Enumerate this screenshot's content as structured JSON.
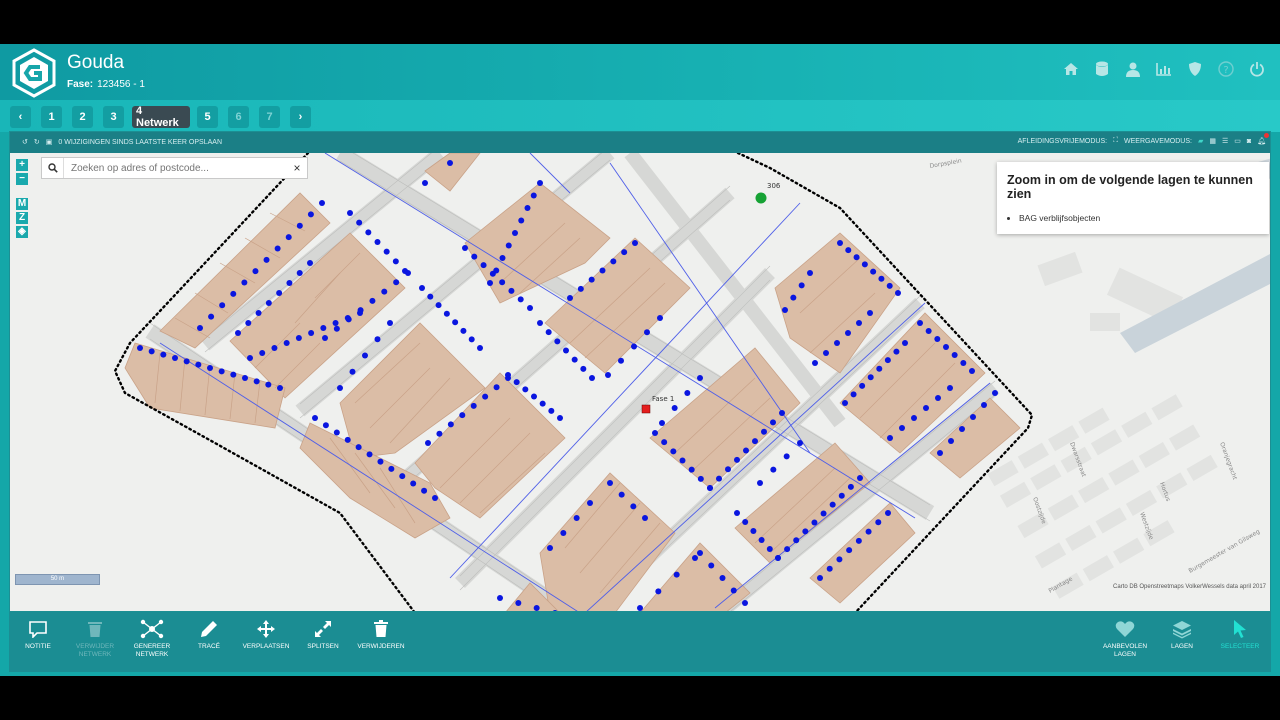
{
  "header": {
    "title": "Gouda",
    "fase_label": "Fase:",
    "fase_value": "123456 - 1",
    "icons": [
      "home-icon",
      "database-icon",
      "user-icon",
      "chart-icon",
      "shield-icon",
      "help-icon",
      "power-icon"
    ]
  },
  "steps": {
    "prev": "‹",
    "next": "›",
    "items": [
      "1",
      "2",
      "3",
      "4 Netwerk",
      "5",
      "6",
      "7"
    ],
    "active": "4 Netwerk"
  },
  "infobar": {
    "changes_text": "0 WIJZIGINGEN SINDS LAATSTE KEER OPSLAAN",
    "derive_mode": "AFLEIDINGSVRIJEMODUS:",
    "view_mode": "WEERGAVEMODUS:"
  },
  "map": {
    "zoom_in": "+",
    "zoom_out": "−",
    "mode_buttons": [
      "M",
      "Z"
    ],
    "search": {
      "placeholder": "Zoeken op adres of postcode...",
      "value": ""
    },
    "search_clear": "×",
    "layer_notice": {
      "title": "Zoom in om de volgende lagen te kunnen zien",
      "items": [
        "BAG verblijfsobjecten"
      ]
    },
    "labels": {
      "point_green": "306",
      "point_red": "Fase 1"
    },
    "scale": "50 m",
    "attribution": "Carto DB Openstreetmaps VolkerWessels data april 2017",
    "streets": [
      "Dorpsplein",
      "Oostzijde",
      "Westzijde",
      "Oranjegracht",
      "Burgemeester van Gilsweg",
      "Plantage",
      "Dwarsstraat",
      "Hortus"
    ]
  },
  "toolbar": {
    "left": [
      {
        "label": "NOTITIE",
        "icon": "comment-icon",
        "state": "normal"
      },
      {
        "label": "VERWIJDER NETWERK",
        "icon": "trash-icon",
        "state": "disabled"
      },
      {
        "label": "GENEREER NETWERK",
        "icon": "network-icon",
        "state": "normal"
      },
      {
        "label": "TRACÉ",
        "icon": "pencil-icon",
        "state": "normal"
      },
      {
        "label": "VERPLAATSEN",
        "icon": "move-icon",
        "state": "normal"
      },
      {
        "label": "SPLITSEN",
        "icon": "split-icon",
        "state": "normal"
      },
      {
        "label": "VERWIJDEREN",
        "icon": "trash-icon",
        "state": "normal"
      }
    ],
    "right": [
      {
        "label": "AANBEVOLEN LAGEN",
        "icon": "heart-icon",
        "state": "normal"
      },
      {
        "label": "LAGEN",
        "icon": "layers-icon",
        "state": "normal"
      },
      {
        "label": "SELECTEER",
        "icon": "cursor-icon",
        "state": "active"
      }
    ]
  },
  "colors": {
    "header": "#17b0b2",
    "toolbar": "#1b8d93",
    "parcel": "#dbbda6",
    "road": "#d6d7d5",
    "cable": "#4f5fe8",
    "address_point": "#0a16e0",
    "boundary": "#000000"
  }
}
